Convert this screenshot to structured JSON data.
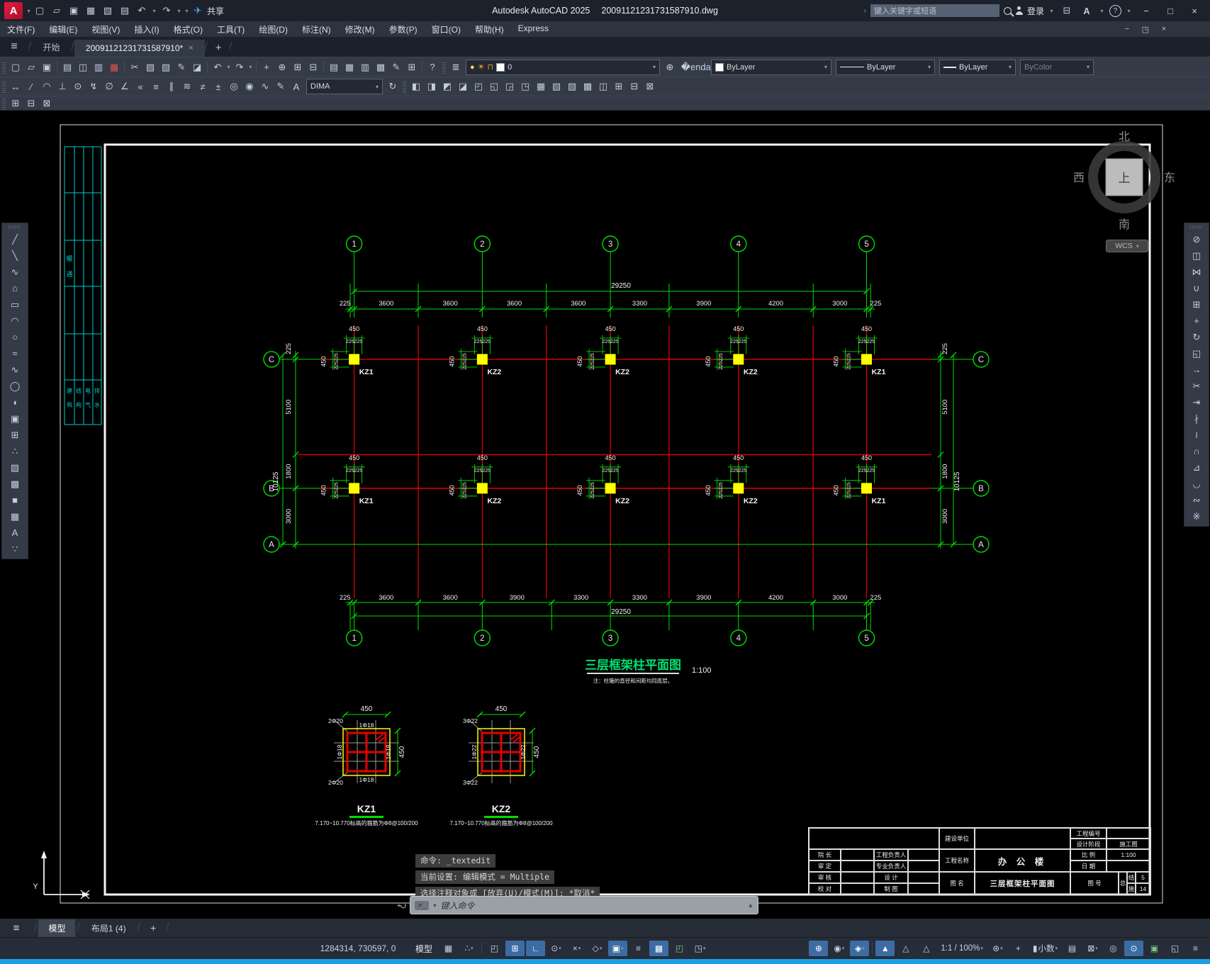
{
  "titlebar": {
    "app_title": "Autodesk AutoCAD 2025",
    "doc_title": "20091121231731587910.dwg",
    "share_label": "共享",
    "search_placeholder": "键入关键字或短语",
    "login_label": "登录"
  },
  "menubar": {
    "items": [
      "文件(F)",
      "编辑(E)",
      "视图(V)",
      "插入(I)",
      "格式(O)",
      "工具(T)",
      "绘图(D)",
      "标注(N)",
      "修改(M)",
      "参数(P)",
      "窗口(O)",
      "帮助(H)",
      "Express"
    ]
  },
  "file_tabs": {
    "start": "开始",
    "document": "20091121231731587910*"
  },
  "toolbars": {
    "layer_value": "0",
    "dim_style": "DIMA",
    "color_value": "ByLayer",
    "linetype_value": "ByLayer",
    "lineweight_value": "ByLayer",
    "plot_style_value": "ByColor",
    "standard": [
      [
        "new-drawing",
        "▢"
      ],
      [
        "open",
        "▱"
      ],
      [
        "save",
        "▣"
      ],
      [
        "|",
        ""
      ],
      [
        "plot",
        "▤"
      ],
      [
        "plot-preview",
        "◫"
      ],
      [
        "publish",
        "▥"
      ],
      [
        "export-dwf",
        "▦",
        "red"
      ],
      [
        "|",
        ""
      ],
      [
        "cut",
        "✂"
      ],
      [
        "copy-clip",
        "▨"
      ],
      [
        "paste",
        "▧"
      ],
      [
        "match-properties",
        "✎"
      ],
      [
        "block-editor",
        "◪"
      ],
      [
        "|",
        ""
      ],
      [
        "undo",
        "↶"
      ],
      [
        "undo-list",
        "▾",
        "car"
      ],
      [
        "redo",
        "↷"
      ],
      [
        "redo-list",
        "▾",
        "car"
      ],
      [
        "|",
        ""
      ],
      [
        "pan",
        "+"
      ],
      [
        "zoom-realtime",
        "⊕"
      ],
      [
        "zoom-window",
        "⊞"
      ],
      [
        "zoom-previous",
        "⊟"
      ],
      [
        "|",
        ""
      ],
      [
        "properties-palette",
        "▤"
      ],
      [
        "design-center",
        "▦"
      ],
      [
        "tool-palettes",
        "▥"
      ],
      [
        "sheet-set-manager",
        "▩"
      ],
      [
        "markup-import",
        "✎"
      ],
      [
        "quick-calc",
        "⊞"
      ],
      [
        "|",
        ""
      ],
      [
        "help",
        "?"
      ]
    ],
    "dimension": [
      [
        "linear-dimension",
        "↔"
      ],
      [
        "aligned-dimension",
        "∕"
      ],
      [
        "arc-length-dimension",
        "◠"
      ],
      [
        "ordinate-dimension",
        "⊥"
      ],
      [
        "radius-dimension",
        "⊙"
      ],
      [
        "jogged-dimension",
        "↯"
      ],
      [
        "diameter-dimension",
        "∅"
      ],
      [
        "angular-dimension",
        "∠"
      ],
      [
        "quick-dimension",
        "«"
      ],
      [
        "baseline-dimension",
        "≡"
      ],
      [
        "continue-dimension",
        "∥"
      ],
      [
        "dimension-space",
        "≋"
      ],
      [
        "dimension-break",
        "≠"
      ],
      [
        "tolerance",
        "±"
      ],
      [
        "center-mark",
        "◎"
      ],
      [
        "inspection-dimension",
        "◉"
      ],
      [
        "jogged-linear",
        "∿"
      ],
      [
        "dimension-edit",
        "✎"
      ],
      [
        "dimension-text-edit",
        "A"
      ]
    ],
    "dimension_update": [
      [
        "dimension-update",
        "↻"
      ]
    ],
    "solids": [
      [
        "solid-union",
        "◧"
      ],
      [
        "solid-subtract",
        "◨"
      ],
      [
        "solid-intersect",
        "◩"
      ],
      [
        "extrude-faces",
        "◪"
      ],
      [
        "move-faces",
        "◰"
      ],
      [
        "offset-faces",
        "◱"
      ],
      [
        "delete-faces",
        "◲"
      ],
      [
        "rotate-faces",
        "◳"
      ],
      [
        "taper-faces",
        "▦"
      ],
      [
        "color-faces",
        "▧"
      ],
      [
        "copy-faces",
        "▨"
      ],
      [
        "copy-edges",
        "▩"
      ],
      [
        "imprint",
        "◫"
      ],
      [
        "clean",
        "⊞"
      ],
      [
        "separate",
        "⊟"
      ],
      [
        "shell",
        "⊠"
      ]
    ],
    "group_row": [
      [
        "group",
        "⊞"
      ],
      [
        "ungroup",
        "⊟"
      ],
      [
        "group-edit",
        "⊠"
      ]
    ],
    "draw_vertical": [
      [
        "line",
        "╱"
      ],
      [
        "construction-line",
        "╲"
      ],
      [
        "polyline",
        "∿"
      ],
      [
        "polygon",
        "⌂"
      ],
      [
        "rectangle",
        "▭"
      ],
      [
        "arc",
        "◠"
      ],
      [
        "circle",
        "○"
      ],
      [
        "revision-cloud",
        "≈"
      ],
      [
        "spline",
        "∿"
      ],
      [
        "ellipse",
        "◯"
      ],
      [
        "ellipse-arc",
        "◖"
      ],
      [
        "insert-block",
        "▣"
      ],
      [
        "make-block",
        "⊞"
      ],
      [
        "point",
        "∴"
      ],
      [
        "hatch",
        "▨"
      ],
      [
        "gradient",
        "▩"
      ],
      [
        "region",
        "■"
      ],
      [
        "table",
        "▦"
      ],
      [
        "multiline-text",
        "A"
      ],
      [
        "donut",
        "∵"
      ]
    ],
    "modify_vertical": [
      [
        "erase",
        "⊘"
      ],
      [
        "copy",
        "◫"
      ],
      [
        "mirror",
        "⋈"
      ],
      [
        "offset",
        "∪"
      ],
      [
        "array",
        "⊞"
      ],
      [
        "move",
        "+"
      ],
      [
        "rotate",
        "↻"
      ],
      [
        "scale",
        "◱"
      ],
      [
        "stretch",
        "→"
      ],
      [
        "trim",
        "✂"
      ],
      [
        "extend",
        "⇥"
      ],
      [
        "break-at-point",
        "∤"
      ],
      [
        "break",
        "≀"
      ],
      [
        "join",
        "∩"
      ],
      [
        "chamfer",
        "⊿"
      ],
      [
        "fillet",
        "◡"
      ],
      [
        "blend-curves",
        "∾"
      ],
      [
        "explode",
        "※"
      ]
    ]
  },
  "drawing": {
    "grid_numbers": [
      "1",
      "2",
      "3",
      "4",
      "5"
    ],
    "row_letters": [
      "C",
      "B",
      "A"
    ],
    "top_dims": [
      225,
      3600,
      3600,
      3600,
      3600,
      3300,
      3900,
      4200,
      3000,
      225
    ],
    "top_total": "29250",
    "bottom_dims": [
      225,
      3600,
      3600,
      3900,
      3300,
      3300,
      3900,
      4200,
      3000,
      225
    ],
    "bottom_total": "29250",
    "side_dims": [
      225,
      5100,
      1800,
      3000
    ],
    "side_total": "10125",
    "column_width_dim": "450",
    "column_half_dims": "225225",
    "column_labels": [
      "KZ1",
      "KZ2",
      "KZ2",
      "KZ2",
      "KZ1"
    ],
    "plan_title": "三层框架柱平面图",
    "plan_scale": "1:100",
    "plan_note": "注：柱箍的直径和间距均同底层。",
    "details": [
      {
        "name": "KZ1",
        "size_dim": "450",
        "corner_bars": "2Φ20",
        "mid_bars": "1Φ18",
        "note": "7.170~10.770标高的箍筋为Φ8@100/200"
      },
      {
        "name": "KZ2",
        "size_dim": "450",
        "corner_bars": "3Φ22",
        "mid_bars": "1Φ22",
        "note": "7.170~10.770标高的箍筋为Φ8@100/200"
      }
    ],
    "sign_strip_mid": "暖通",
    "sign_strip_bottom": [
      "建筑",
      "结构",
      "电气",
      "排水"
    ]
  },
  "viewcube": {
    "north": "北",
    "south": "南",
    "west": "西",
    "east": "东",
    "top": "上",
    "wcs": "WCS"
  },
  "titleblock": {
    "left_labels": [
      [
        "院 长",
        "工程负责人"
      ],
      [
        "审 定",
        "专业负责人"
      ],
      [
        "审 核",
        "设 计"
      ],
      [
        "校 对",
        "制 图"
      ]
    ],
    "owner_label": "建设单位",
    "project_label": "工程名称",
    "project_value": "办 公 楼",
    "figure_label": "图 名",
    "figure_value": "三层框架柱平面图",
    "right_rows": [
      [
        "工程编号",
        ""
      ],
      [
        "设计阶段",
        "施工图"
      ],
      [
        "比 例",
        "1:100"
      ],
      [
        "日 期",
        ""
      ]
    ],
    "figno_label": "图 号",
    "zong": "总",
    "jie": "结",
    "jie_no": "5",
    "shi": "施",
    "shi_no": "14"
  },
  "command": {
    "history": [
      "命令: _textedit",
      "当前设置: 编辑模式 = Multiple",
      "选择注释对象或 [放弃(U)/模式(M)]: *取消*"
    ],
    "placeholder": "键入命令"
  },
  "layout_tabs": {
    "model": "模型",
    "layout1": "布局1 (4)"
  },
  "statusbar": {
    "coords": "1284314, 730597, 0",
    "model_label": "模型",
    "scale_label": "1:1 / 100%",
    "units_label": "小数",
    "left_icons": [
      [
        "grid-display",
        "▦",
        ""
      ],
      [
        "snap-mode",
        "∴",
        "c"
      ],
      [
        "|",
        "",
        ""
      ],
      [
        "infer-constraints",
        "◰",
        ""
      ],
      [
        "dynamic-input",
        "⊞",
        "a"
      ],
      [
        "ortho-mode",
        "∟",
        "a"
      ],
      [
        "polar-tracking",
        "⊙",
        "c"
      ],
      [
        "object-snap-tracking",
        "×",
        "c"
      ],
      [
        "isometric-drafting",
        "◇",
        "c"
      ],
      [
        "object-snap",
        "▣",
        "ac"
      ],
      [
        "lineweight-display",
        "≡",
        ""
      ],
      [
        "transparency",
        "▩",
        "a"
      ],
      [
        "selection-cycling",
        "◰",
        "g"
      ],
      [
        "3d-object-snap",
        "◳",
        "c"
      ]
    ],
    "right_icons_a": [
      [
        "annotation-monitor",
        "⊕",
        "a"
      ],
      [
        "annotation-visibility",
        "◉",
        "c"
      ],
      [
        "isodraft",
        "◈",
        "ac"
      ]
    ],
    "right_icons_b": [
      [
        "auto-annotation-scale",
        "▲",
        "a"
      ],
      [
        "annotation-scale-list",
        "△",
        ""
      ],
      [
        "annotation-scale",
        "△",
        ""
      ]
    ],
    "right_icons_c": [
      [
        "annotation-settings-gear",
        "⊛",
        "c"
      ],
      [
        "add-scales",
        "+",
        ""
      ]
    ],
    "right_icons_d": [
      [
        "quick-properties",
        "▤",
        ""
      ],
      [
        "lock-ui",
        "⊠",
        "c"
      ],
      [
        "isolate-objects",
        "◎",
        ""
      ],
      [
        "graphics-performance",
        "⊙",
        "a"
      ],
      [
        "trusted-dwg",
        "▣",
        "g"
      ],
      [
        "clean-screen",
        "◱",
        ""
      ],
      [
        "customization-menu",
        "≡",
        ""
      ]
    ]
  }
}
